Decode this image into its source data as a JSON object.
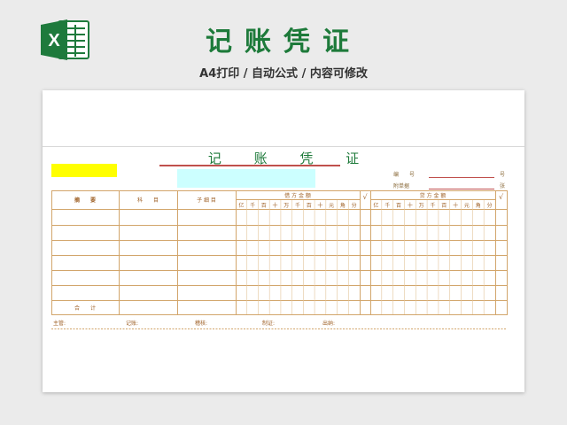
{
  "header": {
    "title": "记账凭证",
    "subtitle": "A4打印 / 自动公式 / 内容可修改",
    "logo_letter": "X",
    "brand_color": "#1e7a3c"
  },
  "voucher": {
    "title": "记 账 凭 证",
    "meta": {
      "number_label": "编　　号",
      "number_unit": "号",
      "attach_label": "附单据",
      "attach_unit": "张"
    },
    "columns": {
      "summary": "摘　　要",
      "subject": "科　　目",
      "sub_ledger": "子 细 目",
      "debit": "借 方 金 额",
      "credit": "贷 方 金 额",
      "check": "√"
    },
    "amount_digits": [
      "亿",
      "千",
      "百",
      "十",
      "万",
      "千",
      "百",
      "十",
      "元",
      "角",
      "分"
    ],
    "total_label": "合　　计",
    "footer": {
      "supervisor": "主管:",
      "bookkeeper": "记账:",
      "reviewer": "稽核:",
      "preparer": "制证:",
      "cashier": "出纳:"
    },
    "colors": {
      "line": "#d2a56b",
      "text": "#a0632a",
      "title": "#1d7a3a",
      "highlight_yellow": "#ffff00",
      "highlight_cyan": "#ccffff",
      "accent_red": "#c0504d"
    }
  }
}
